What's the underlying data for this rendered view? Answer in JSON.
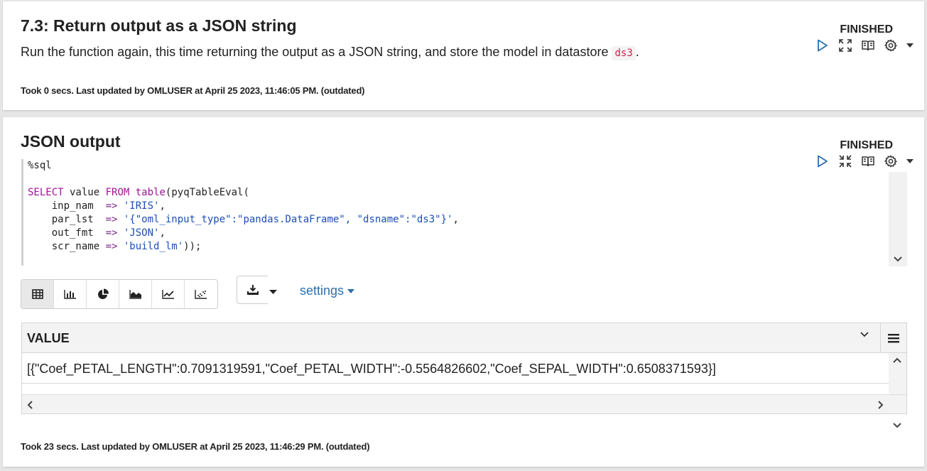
{
  "paragraph1": {
    "title": "7.3: Return output as a JSON string",
    "description_before": "Run the function again, this time returning the output as a JSON string, and store the model in datastore ",
    "description_code": "ds3",
    "description_after": ".",
    "status": "FINISHED",
    "footer": "Took 0 secs. Last updated by OMLUSER at April 25 2023, 11:46:05 PM. (outdated)",
    "controls": [
      "run-icon",
      "expand-icon",
      "book-icon",
      "gear-icon",
      "caret-down-icon"
    ]
  },
  "paragraph2": {
    "title": "JSON output",
    "status": "FINISHED",
    "controls": [
      "run-icon",
      "collapse-icon",
      "book-icon",
      "gear-icon",
      "caret-down-icon"
    ],
    "code": {
      "interpreter": "%sql",
      "line_select_kw1": "SELECT",
      "line_select_mid": " value ",
      "line_select_kw2": "FROM",
      "line_select_sp": " ",
      "line_select_kw3": "table",
      "line_select_end": "(pyqTableEval(",
      "args": [
        {
          "name": "    inp_nam  ",
          "arrow": "=>",
          "value": "'IRIS'",
          "end": ","
        },
        {
          "name": "    par_lst  ",
          "arrow": "=>",
          "value": "'{\"oml_input_type\":\"pandas.DataFrame\", \"dsname\":\"ds3\"}'",
          "end": ","
        },
        {
          "name": "    out_fmt  ",
          "arrow": "=>",
          "value": "'JSON'",
          "end": ","
        },
        {
          "name": "    scr_name ",
          "arrow": "=>",
          "value": "'build_lm'",
          "end": "));"
        }
      ]
    },
    "viz_buttons": [
      "table-icon",
      "bar-chart-icon",
      "pie-chart-icon",
      "area-chart-icon",
      "line-chart-icon",
      "scatter-chart-icon"
    ],
    "download_icon": "download-icon",
    "settings_label": "settings",
    "table": {
      "column": "VALUE",
      "rows": [
        "[{\"Coef_PETAL_LENGTH\":0.7091319591,\"Coef_PETAL_WIDTH\":-0.5564826602,\"Coef_SEPAL_WIDTH\":0.6508371593}]"
      ]
    },
    "footer": "Took 23 secs. Last updated by OMLUSER at April 25 2023, 11:46:29 PM. (outdated)"
  },
  "colors": {
    "accent": "#2a6fb0",
    "keyword": "#a0129a",
    "string": "#1b4fb3",
    "inline_code": "#c7254e"
  }
}
